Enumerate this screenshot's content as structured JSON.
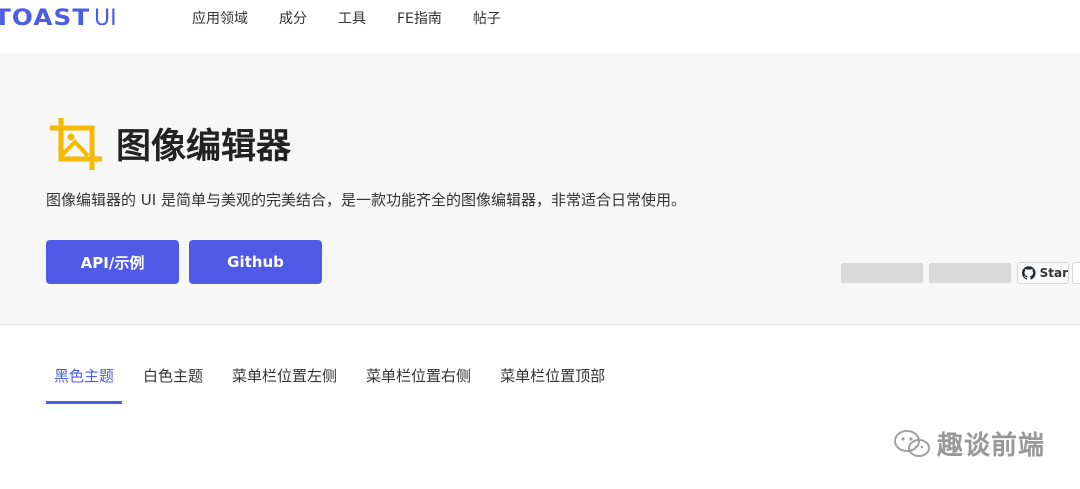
{
  "logo": {
    "strong": "TOAST",
    "light": "UI"
  },
  "nav": {
    "items": [
      {
        "label": "应用领域"
      },
      {
        "label": "成分"
      },
      {
        "label": "工具"
      },
      {
        "label": "FE指南"
      },
      {
        "label": "帖子"
      }
    ]
  },
  "hero": {
    "title": "图像编辑器",
    "description": "图像编辑器的 UI 是简单与美观的完美结合，是一款功能齐全的图像编辑器，非常适合日常使用。",
    "icon": "image-crop-icon",
    "accent_color": "#f5b900",
    "buttons": {
      "api_label": "API/示例",
      "github_label": "Github"
    },
    "star_label": "Star"
  },
  "tabs": {
    "items": [
      {
        "label": "黑色主题",
        "active": true
      },
      {
        "label": "白色主题",
        "active": false
      },
      {
        "label": "菜单栏位置左侧",
        "active": false
      },
      {
        "label": "菜单栏位置右侧",
        "active": false
      },
      {
        "label": "菜单栏位置顶部",
        "active": false
      }
    ]
  },
  "watermark": {
    "text": "趣谈前端",
    "icon": "wechat-icon"
  },
  "colors": {
    "primary": "#4f5ae6",
    "hero_bg": "#f7f7f7"
  }
}
